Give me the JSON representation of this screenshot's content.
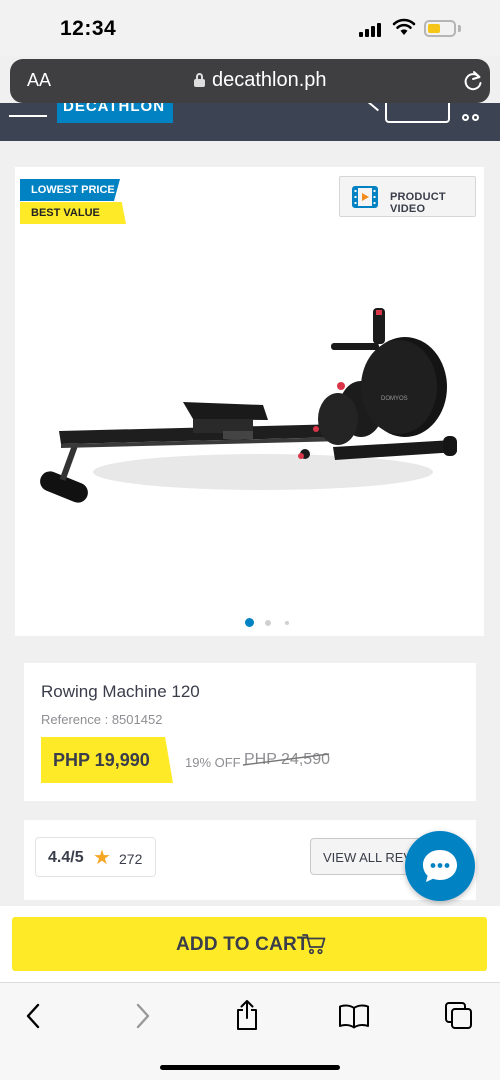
{
  "status_bar": {
    "time": "12:34",
    "battery_color": "#f5c518"
  },
  "browser": {
    "text_size_label": "AA",
    "url": "decathlon.ph"
  },
  "site_header": {
    "logo_fragment": "DECATHLON",
    "brand_color": "#0082c3"
  },
  "product_media": {
    "badges": [
      "LOWEST PRICE",
      "BEST VALUE"
    ],
    "video_button_label": "PRODUCT VIDEO",
    "image_brand_text": "DOMYOS",
    "carousel": {
      "total": 3,
      "active_index": 0
    }
  },
  "product": {
    "name": "Rowing Machine 120",
    "reference": "Reference : 8501452",
    "price": "PHP 19,990",
    "discount": "19% OFF",
    "original_price": "PHP 24,590"
  },
  "reviews": {
    "rating": "4.4/5",
    "count": "272",
    "view_all_label": "VIEW ALL REVIEWS"
  },
  "cart": {
    "add_to_cart_label": "ADD TO CART"
  },
  "colors": {
    "accent_yellow": "#ffea28",
    "accent_blue": "#0082c3",
    "text_dark": "#3a3d4a"
  },
  "icons": [
    "signal-icon",
    "wifi-icon",
    "battery-icon",
    "lock-icon",
    "reload-icon",
    "menu-icon",
    "search-icon",
    "account-icon",
    "video-icon",
    "star-icon",
    "chat-icon",
    "cart-icon",
    "back-icon",
    "forward-icon",
    "share-icon",
    "bookmarks-icon",
    "tabs-icon"
  ]
}
